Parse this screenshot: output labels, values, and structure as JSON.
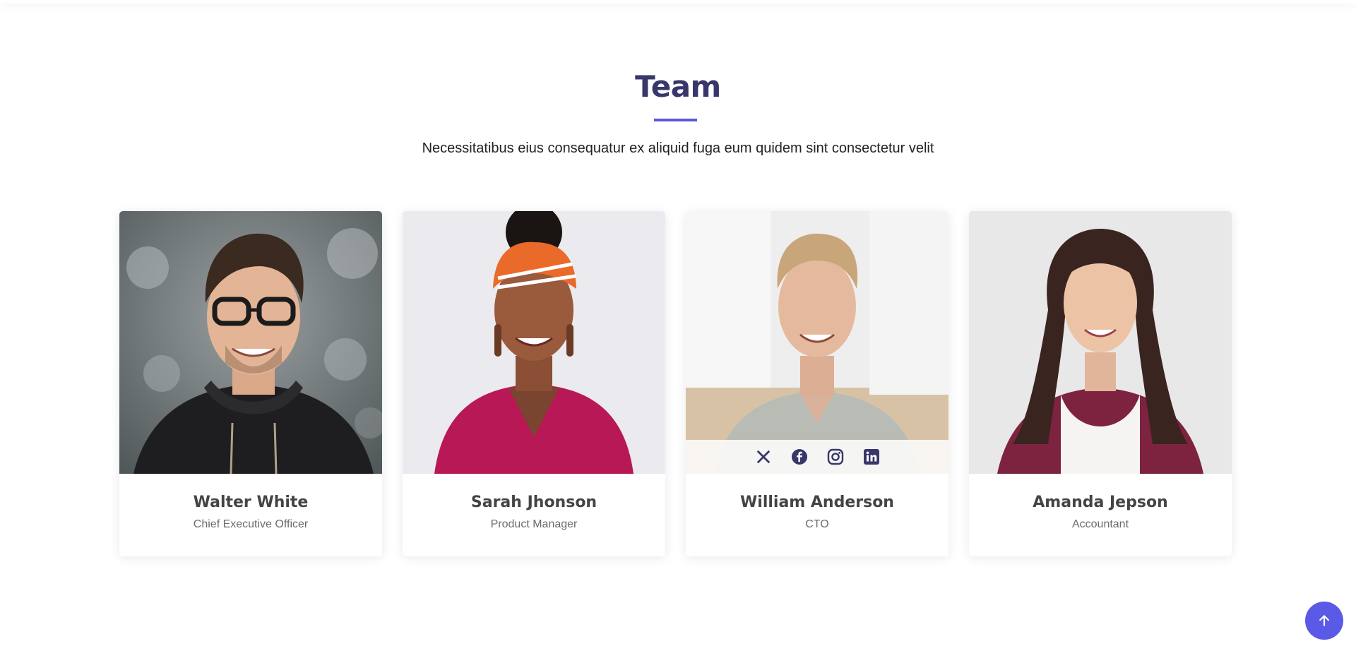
{
  "section": {
    "title": "Team",
    "description": "Necessitatibus eius consequatur ex aliquid fuga eum quidem sint consectetur velit"
  },
  "members": [
    {
      "name": "Walter White",
      "role": "Chief Executive Officer",
      "photo": "man-glasses-hoodie-photo"
    },
    {
      "name": "Sarah Jhonson",
      "role": "Product Manager",
      "photo": "woman-headwrap-photo"
    },
    {
      "name": "William Anderson",
      "role": "CTO",
      "photo": "man-polo-photo"
    },
    {
      "name": "Amanda Jepson",
      "role": "Accountant",
      "photo": "woman-cardigan-photo"
    }
  ],
  "social_icons": [
    "x-twitter-icon",
    "facebook-icon",
    "instagram-icon",
    "linkedin-icon"
  ],
  "back_to_top_icon": "arrow-up-icon",
  "colors": {
    "title": "#37376b",
    "accent": "#5a58d6",
    "back_to_top": "#5a5ae6",
    "social_icon": "#37376b"
  }
}
